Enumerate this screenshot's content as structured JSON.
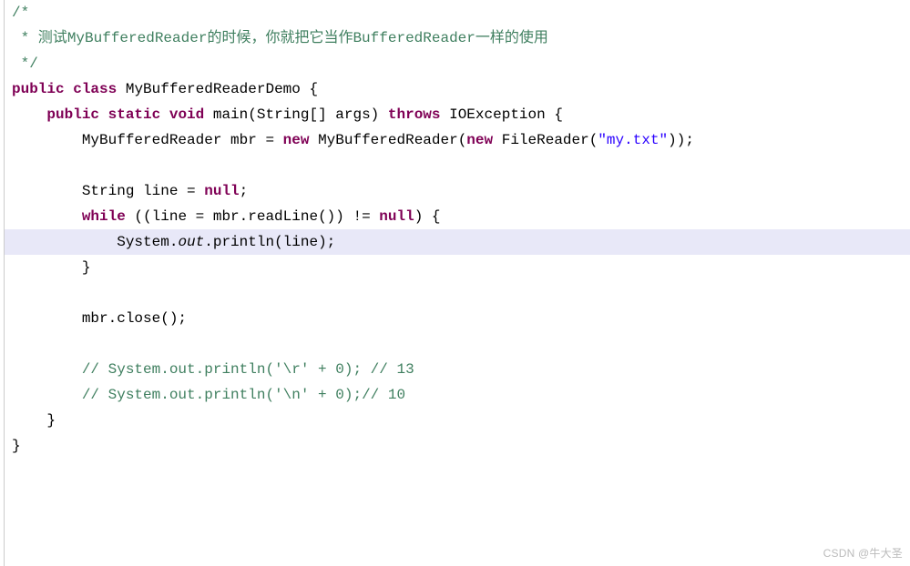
{
  "code": {
    "l1": "/*",
    "l2a": " * 测试",
    "l2b": "MyBufferedReader",
    "l2c": "的时候，你就把它当作",
    "l2d": "BufferedReader",
    "l2e": "一样的使用",
    "l3": " */",
    "l4_public": "public",
    "l4_class": "class",
    "l4_name": "MyBufferedReaderDemo",
    "l4_brace": " {",
    "l5_indent": "    ",
    "l5_public": "public",
    "l5_static": "static",
    "l5_void": "void",
    "l5_main": " main(String[] args) ",
    "l5_throws": "throws",
    "l5_ex": " IOException {",
    "l6_indent": "        ",
    "l6_a": "MyBufferedReader mbr = ",
    "l6_new1": "new",
    "l6_b": " MyBufferedReader(",
    "l6_new2": "new",
    "l6_c": " FileReader(",
    "l6_str": "\"my.txt\"",
    "l6_d": "));",
    "l7": "        ",
    "l8_indent": "        ",
    "l8_a": "String line = ",
    "l8_null": "null",
    "l8_b": ";",
    "l9_indent": "        ",
    "l9_while": "while",
    "l9_a": " ((line = mbr.readLine()) != ",
    "l9_null": "null",
    "l9_b": ") {",
    "l10_indent": "            ",
    "l10_a": "System.",
    "l10_out": "out",
    "l10_b": ".println(line);",
    "l11": "        }",
    "l12": "        ",
    "l13_indent": "        ",
    "l13_a": "mbr.close();",
    "l14": "        ",
    "l15_indent": "        ",
    "l15_c": "// System.out.println('\\r' + 0); // 13",
    "l16_indent": "        ",
    "l16_c": "// System.out.println('\\n' + 0);// 10",
    "l17": "    }",
    "l18": "}"
  },
  "watermark": "CSDN @牛大圣"
}
